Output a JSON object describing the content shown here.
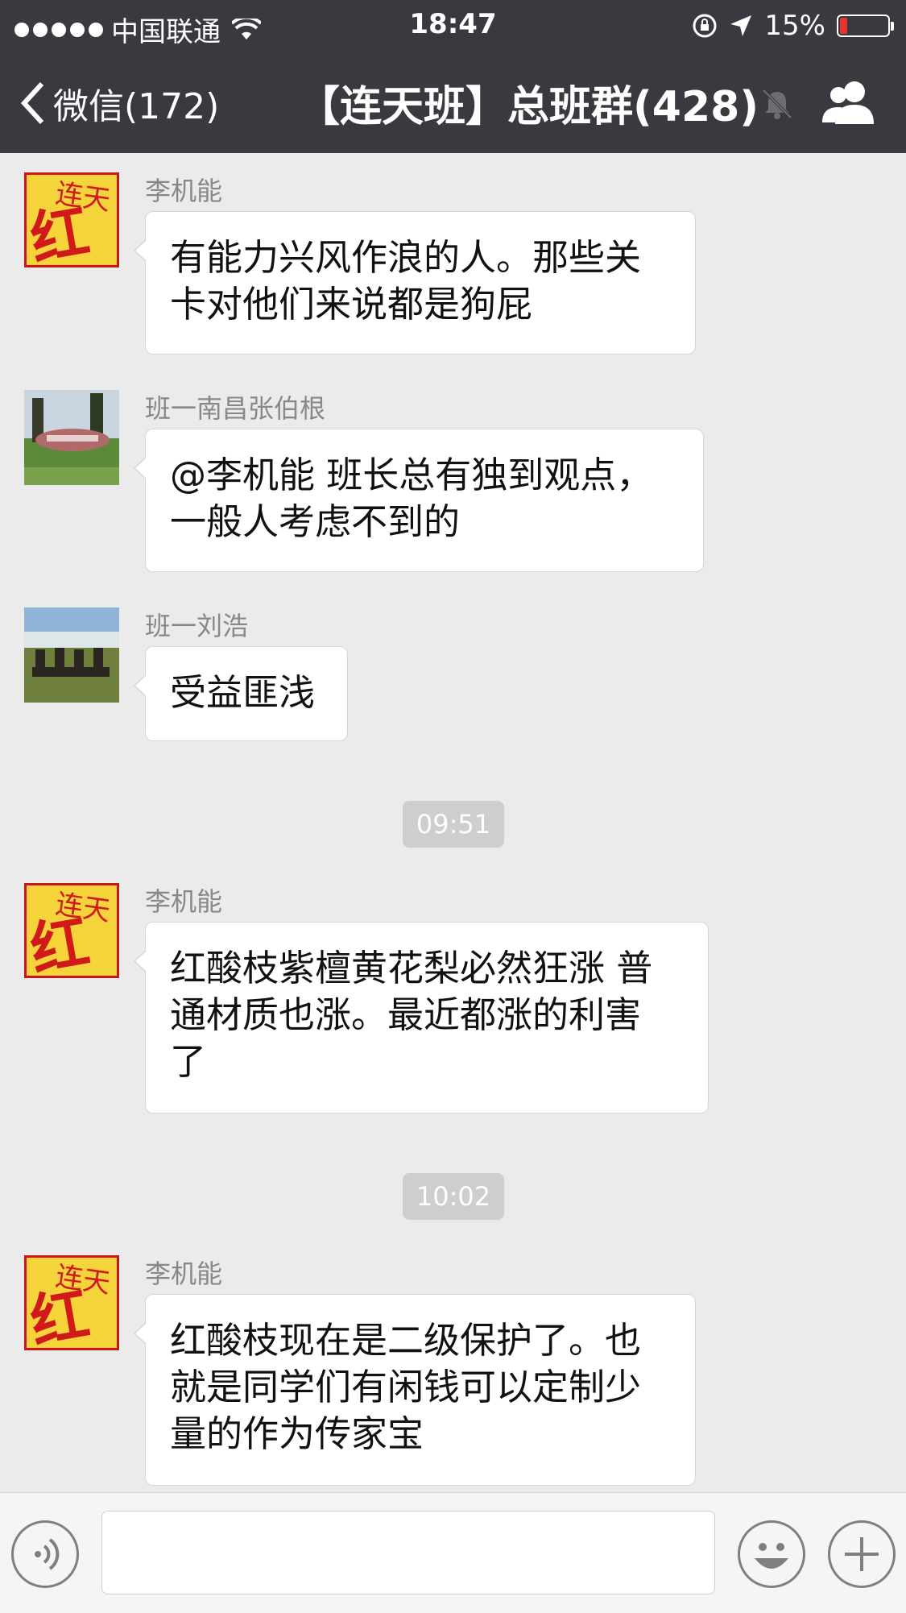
{
  "status_bar": {
    "carrier": "中国联通",
    "time": "18:47",
    "battery": "15%",
    "battery_level": 0.15
  },
  "nav": {
    "back_label": "微信(172)",
    "title": "【连天班】总班群(428)"
  },
  "messages": [
    {
      "sender": "李机能",
      "avatar": "red-logo",
      "text": "有能力兴风作浪的人。那些关\n卡对他们来说都是狗屁"
    },
    {
      "sender": "班一南昌张伯根",
      "avatar": "photo-stone",
      "text": "@李机能 班长总有独到观点，\n一般人考虑不到的"
    },
    {
      "sender": "班一刘浩",
      "avatar": "photo-horses",
      "text": "受益匪浅"
    },
    {
      "timestamp": "09:51"
    },
    {
      "sender": "李机能",
      "avatar": "red-logo",
      "text": "红酸枝紫檀黄花梨必然狂涨 普\n通材质也涨。最近都涨的利害\n了"
    },
    {
      "timestamp": "10:02"
    },
    {
      "sender": "李机能",
      "avatar": "red-logo",
      "text": "红酸枝现在是二级保护了。也\n就是同学们有闲钱可以定制少\n量的作为传家宝"
    }
  ],
  "logo": {
    "big": "红",
    "small": "连天"
  },
  "input": {
    "placeholder": ""
  },
  "colors": {
    "nav_bg": "#393a3f",
    "chat_bg": "#ebebeb",
    "logo_red": "#c8161e",
    "logo_yellow": "#f5d33a"
  }
}
